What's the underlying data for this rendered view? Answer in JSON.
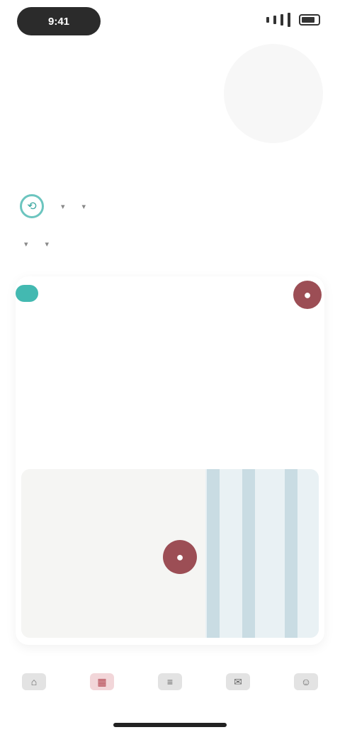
{
  "status": {
    "time": "9:41"
  },
  "hero": {
    "circle_text": ""
  },
  "header": {
    "eyebrow": "",
    "title": ""
  },
  "filters": {
    "row1": [
      "",
      ""
    ],
    "row2": [
      "",
      ""
    ]
  },
  "card": {
    "badge": "",
    "message": "",
    "alert": ""
  },
  "map": {
    "expand": ""
  },
  "tabs": [
    "",
    "",
    "",
    "",
    ""
  ],
  "colors": {
    "teal": "#43b9b1",
    "accent": "#9c4e55",
    "alert": "#c45566"
  },
  "icons": {
    "top_fab": "location-icon",
    "map_pin": "map-pin-icon",
    "teal": "filter-icon"
  }
}
